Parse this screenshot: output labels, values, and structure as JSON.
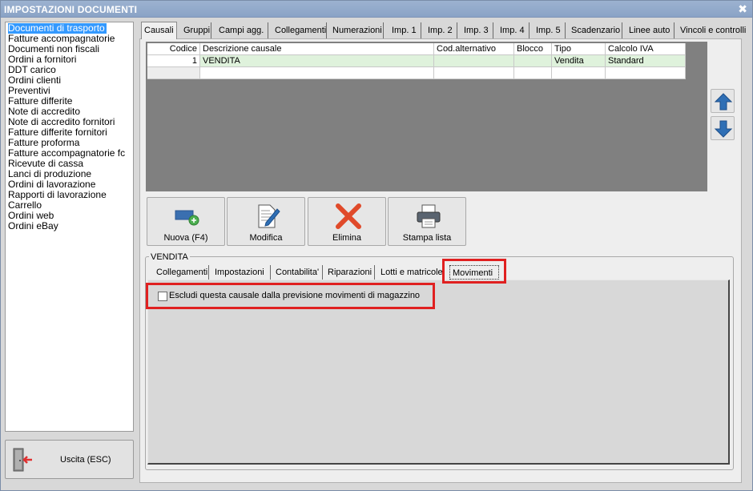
{
  "window": {
    "title": "IMPOSTAZIONI DOCUMENTI",
    "close_glyph": "✖"
  },
  "doc_list": {
    "selected_index": 0,
    "items": [
      "Documenti di trasporto",
      "Fatture accompagnatorie",
      "Documenti non fiscali",
      "Ordini a fornitori",
      "DDT carico",
      "Ordini clienti",
      "Preventivi",
      "Fatture differite",
      "Note di accredito",
      "Note di accredito fornitori",
      "Fatture differite fornitori",
      "Fatture proforma",
      "Fatture accompagnatorie fc",
      "Ricevute di cassa",
      "Lanci di produzione",
      "Ordini di lavorazione",
      "Rapporti di lavorazione",
      "Carrello",
      "Ordini web",
      "Ordini eBay"
    ]
  },
  "exit_button": {
    "label": "Uscita (ESC)",
    "icon": "exit-door-icon"
  },
  "main_tabs": {
    "active": "Causali",
    "items": [
      "Causali",
      "Gruppi",
      "Campi agg.",
      "Collegamenti",
      "Numerazioni",
      "Imp. 1",
      "Imp. 2",
      "Imp. 3",
      "Imp. 4",
      "Imp. 5",
      "Scadenzario",
      "Linee auto",
      "Vincoli e controlli"
    ]
  },
  "grid": {
    "columns": [
      "Codice",
      "Descrizione causale",
      "Cod.alternativo",
      "Blocco",
      "Tipo",
      "Calcolo IVA"
    ],
    "rows": [
      {
        "codice": "1",
        "descrizione": "VENDITA",
        "cod_alternativo": "",
        "blocco": "",
        "tipo": "Vendita",
        "calcolo_iva": "Standard"
      }
    ],
    "selected_row_color": "#dff2dc"
  },
  "move_buttons": {
    "up_icon": "arrow-up-icon",
    "down_icon": "arrow-down-icon",
    "color": "#2f6fb5"
  },
  "actions": {
    "new": "Nuova (F4)",
    "edit": "Modifica",
    "delete": "Elimina",
    "print": "Stampa lista"
  },
  "detail": {
    "group_title": "VENDITA",
    "active_tab": "Movimenti",
    "tabs": [
      "Collegamenti",
      "Impostazioni",
      "Contabilita'",
      "Riparazioni",
      "Lotti e matricole",
      "Movimenti"
    ],
    "checkbox_label": "Escludi questa causale dalla previsione movimenti di magazzino",
    "checkbox_checked": false
  },
  "colors": {
    "highlight_red": "#e02020",
    "selection_blue": "#3399ff",
    "title_bar": "#8aa3c6"
  }
}
